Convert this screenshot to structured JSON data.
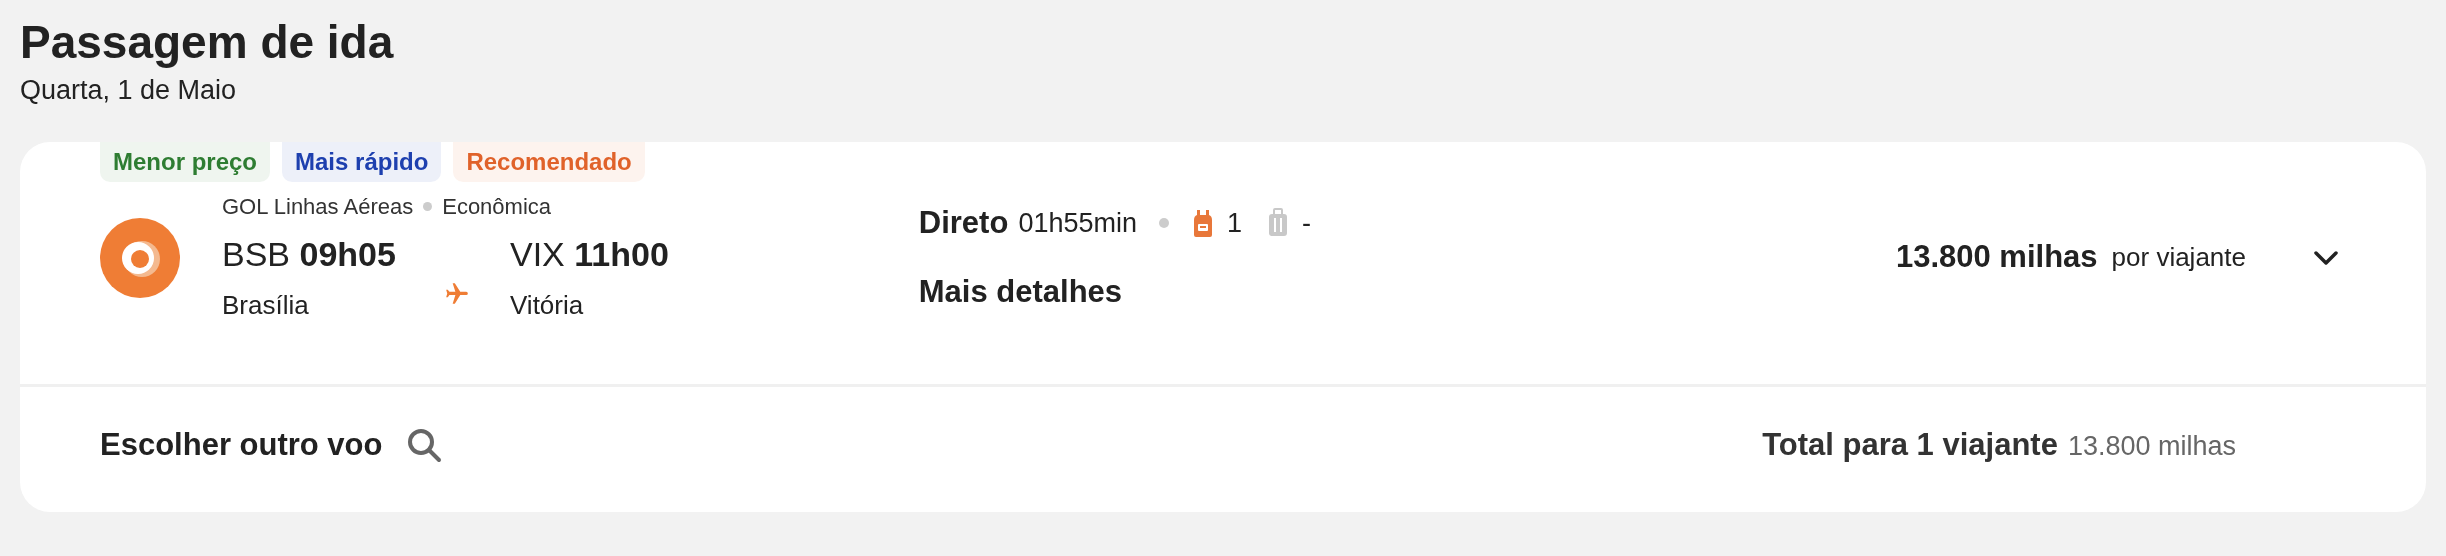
{
  "header": {
    "title": "Passagem de ida",
    "date": "Quarta, 1 de Maio"
  },
  "flight": {
    "tags": [
      {
        "label": "Menor preço",
        "color": "#2e7d32"
      },
      {
        "label": "Mais rápido",
        "color": "#1e40af"
      },
      {
        "label": "Recomendado",
        "color": "#e0622a"
      }
    ],
    "airline": "GOL Linhas Aéreas",
    "cabin": "Econômica",
    "origin": {
      "code": "BSB",
      "time": "09h05",
      "city": "Brasília"
    },
    "destination": {
      "code": "VIX",
      "time": "11h00",
      "city": "Vitória"
    },
    "stops": "Direto",
    "duration": "01h55min",
    "baggage": [
      {
        "kind": "backpack",
        "included": true,
        "count": "1"
      },
      {
        "kind": "suitcase",
        "included": false,
        "count": "-"
      }
    ],
    "details_link": "Mais detalhes",
    "price": "13.800 milhas",
    "price_unit": "por viajante",
    "expanded": false
  },
  "footer": {
    "choose_other": "Escolher outro voo",
    "total_label": "Total para 1 viajante",
    "total_value": "13.800 milhas"
  }
}
